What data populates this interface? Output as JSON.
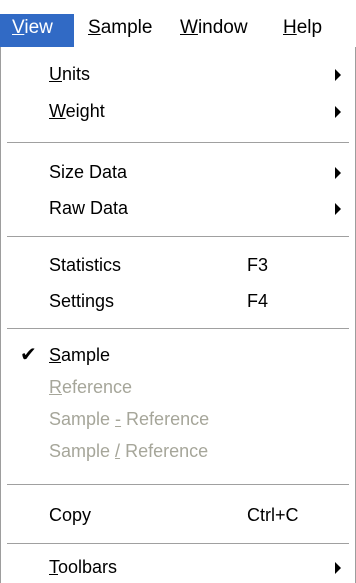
{
  "menubar": {
    "items": [
      {
        "pre": "",
        "u": "V",
        "post": "iew"
      },
      {
        "pre": "",
        "u": "S",
        "post": "ample"
      },
      {
        "pre": "",
        "u": "W",
        "post": "indow"
      },
      {
        "pre": "",
        "u": "H",
        "post": "elp"
      }
    ]
  },
  "menu": {
    "units": {
      "pre": "",
      "u": "U",
      "post": "nits"
    },
    "weight": {
      "pre": "",
      "u": "W",
      "post": "eight"
    },
    "size_data": {
      "label": "Size Data"
    },
    "raw_data": {
      "label": "Raw Data"
    },
    "statistics": {
      "label": "Statistics",
      "shortcut": "F3"
    },
    "settings": {
      "label": "Settings",
      "shortcut": "F4"
    },
    "sample": {
      "pre": "",
      "u": "S",
      "post": "ample",
      "checked": true
    },
    "reference": {
      "pre": "",
      "u": "R",
      "post": "eference"
    },
    "sample_minus": {
      "pre": "Sample ",
      "u": "-",
      "post": " Reference"
    },
    "sample_div": {
      "pre": "Sample ",
      "u": "/",
      "post": " Reference"
    },
    "copy": {
      "label": "Copy",
      "shortcut": "Ctrl+C"
    },
    "toolbars": {
      "pre": "",
      "u": "T",
      "post": "oolbars"
    }
  },
  "icons": {
    "check": "checkmark-icon",
    "submenu": "submenu-arrow-icon"
  },
  "colors": {
    "highlight": "#316ac5",
    "disabled_text": "#a6a69a"
  }
}
